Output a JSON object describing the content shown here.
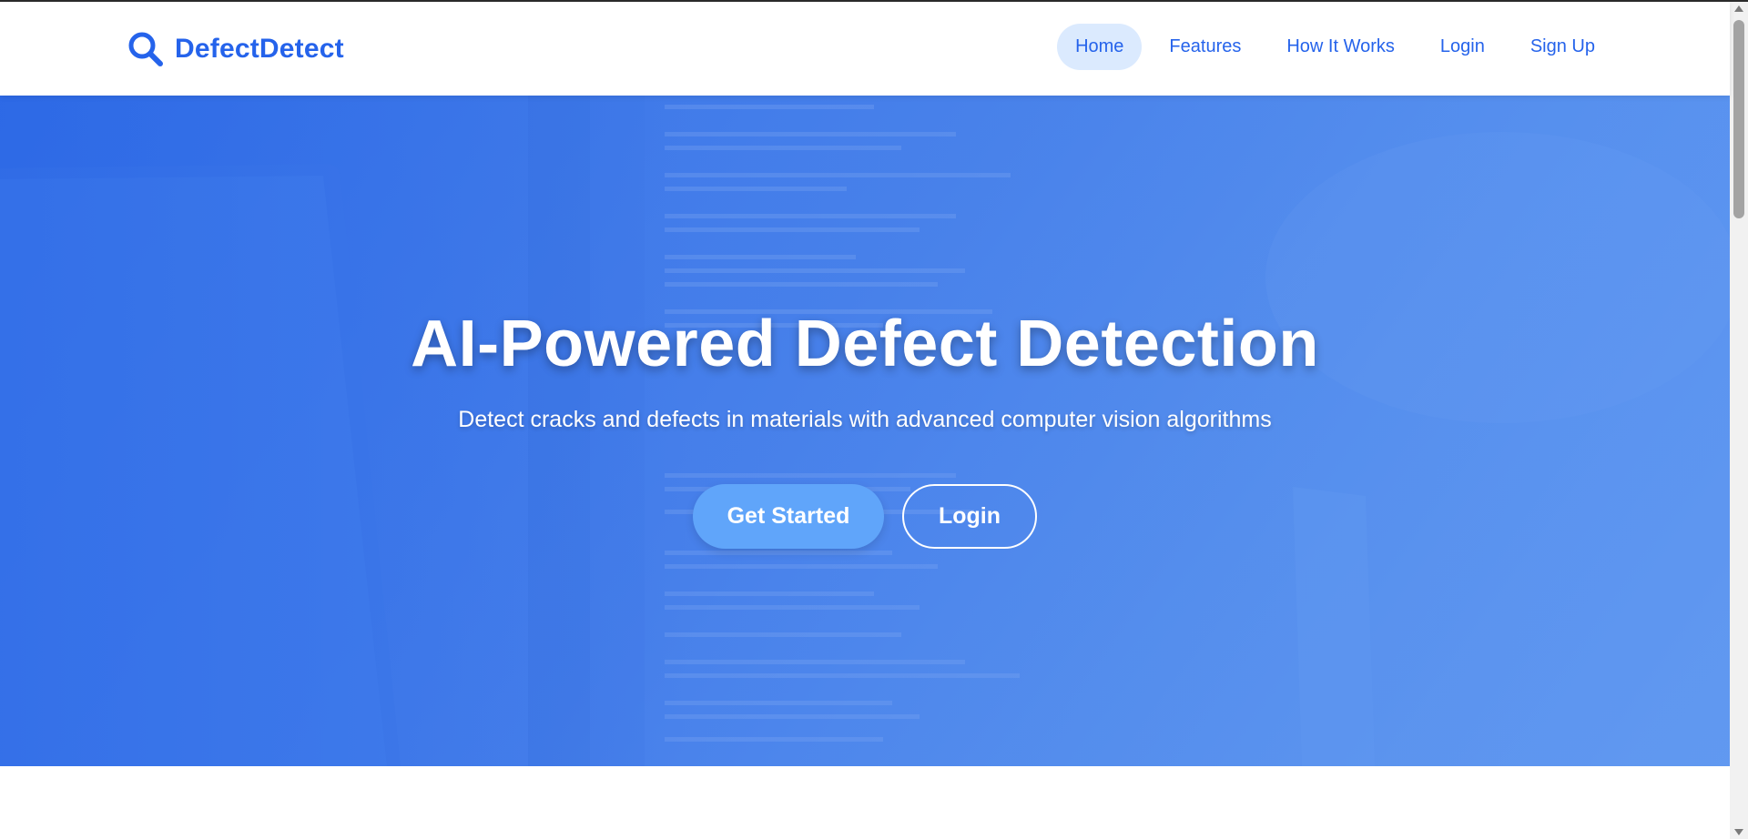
{
  "brand": {
    "name": "DefectDetect",
    "icon": "search-icon"
  },
  "nav": {
    "items": [
      {
        "label": "Home",
        "active": true
      },
      {
        "label": "Features",
        "active": false
      },
      {
        "label": "How It Works",
        "active": false
      },
      {
        "label": "Login",
        "active": false
      },
      {
        "label": "Sign Up",
        "active": false
      }
    ]
  },
  "hero": {
    "title": "AI-Powered Defect Detection",
    "subtitle": "Detect cracks and defects in materials with advanced computer vision algorithms",
    "primary_button": "Get Started",
    "secondary_button": "Login"
  },
  "colors": {
    "brand": "#2563eb",
    "nav_active_bg": "#dbeafe",
    "hero_bg": "#4a82ea",
    "primary_button_bg": "#60a5fa"
  }
}
